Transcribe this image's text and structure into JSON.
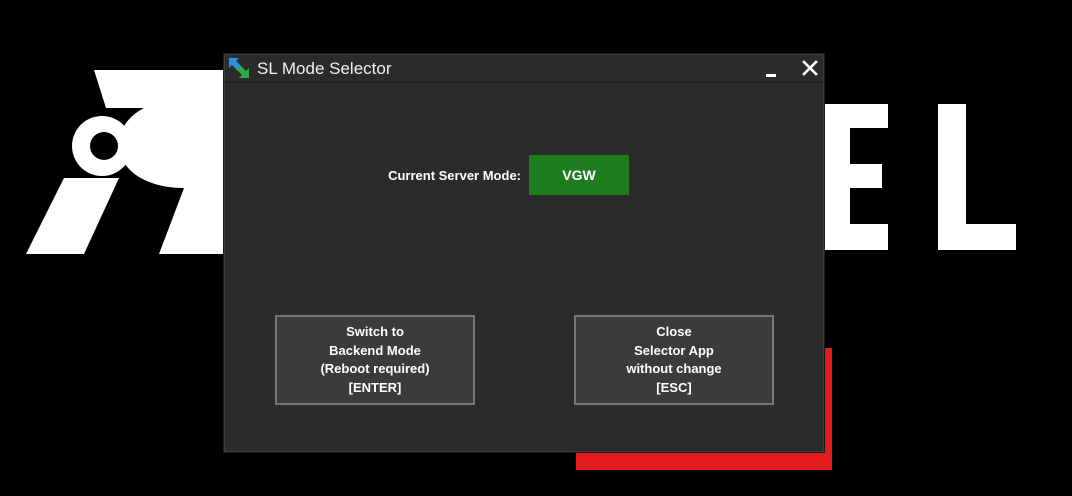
{
  "window": {
    "title": "SL Mode Selector",
    "minimize_symbol": "_",
    "close_symbol": "✕"
  },
  "status": {
    "label": "Current Server Mode:",
    "mode_value": "VGW",
    "mode_color": "#1e7d1e"
  },
  "buttons": {
    "switch": {
      "lines": [
        "Switch to",
        "Backend Mode",
        "(Reboot required)",
        "[ENTER]"
      ]
    },
    "close": {
      "lines": [
        "Close",
        "Selector App",
        "without change",
        "[ESC]"
      ]
    }
  },
  "background": {
    "accent_color": "#e21c1c"
  },
  "icons": {
    "app": "swap-arrows-icon",
    "minimize": "minimize-icon",
    "close": "close-icon"
  }
}
